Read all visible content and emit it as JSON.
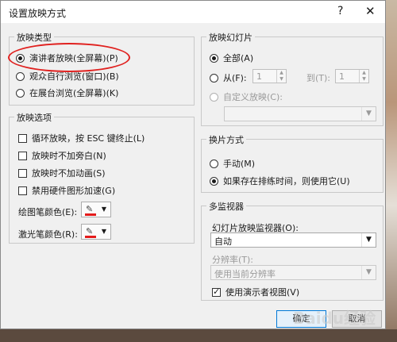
{
  "dialog": {
    "title": "设置放映方式",
    "help_glyph": "?",
    "close_glyph": "✕"
  },
  "show_type": {
    "label": "放映类型",
    "options": [
      {
        "label": "演讲者放映(全屏幕)(P)",
        "selected": true
      },
      {
        "label": "观众自行浏览(窗口)(B)",
        "selected": false
      },
      {
        "label": "在展台浏览(全屏幕)(K)",
        "selected": false
      }
    ]
  },
  "show_options": {
    "label": "放映选项",
    "checkboxes": [
      {
        "label": "循环放映，按 ESC 键终止(L)",
        "checked": false
      },
      {
        "label": "放映时不加旁白(N)",
        "checked": false
      },
      {
        "label": "放映时不加动画(S)",
        "checked": false
      },
      {
        "label": "禁用硬件图形加速(G)",
        "checked": false
      }
    ],
    "pen_color_label": "绘图笔颜色(E):",
    "laser_color_label": "激光笔颜色(R):",
    "pen_color": "#e41b1b",
    "laser_color": "#e41b1b"
  },
  "slides": {
    "label": "放映幻灯片",
    "all_label": "全部(A)",
    "from_label": "从(F):",
    "from_value": "1",
    "to_label": "到(T):",
    "to_value": "1",
    "custom_label": "自定义放映(C):",
    "custom_value": ""
  },
  "advance": {
    "label": "换片方式",
    "manual_label": "手动(M)",
    "timing_label": "如果存在排练时间，则使用它(U)"
  },
  "monitors": {
    "label": "多监视器",
    "monitor_label": "幻灯片放映监视器(O):",
    "monitor_value": "自动",
    "resolution_label": "分辨率(T):",
    "resolution_value": "使用当前分辨率",
    "presenter_view_label": "使用演示者视图(V)",
    "presenter_view_checked": true
  },
  "buttons": {
    "ok": "确定",
    "cancel": "取消"
  },
  "watermark": "Baidu经验"
}
